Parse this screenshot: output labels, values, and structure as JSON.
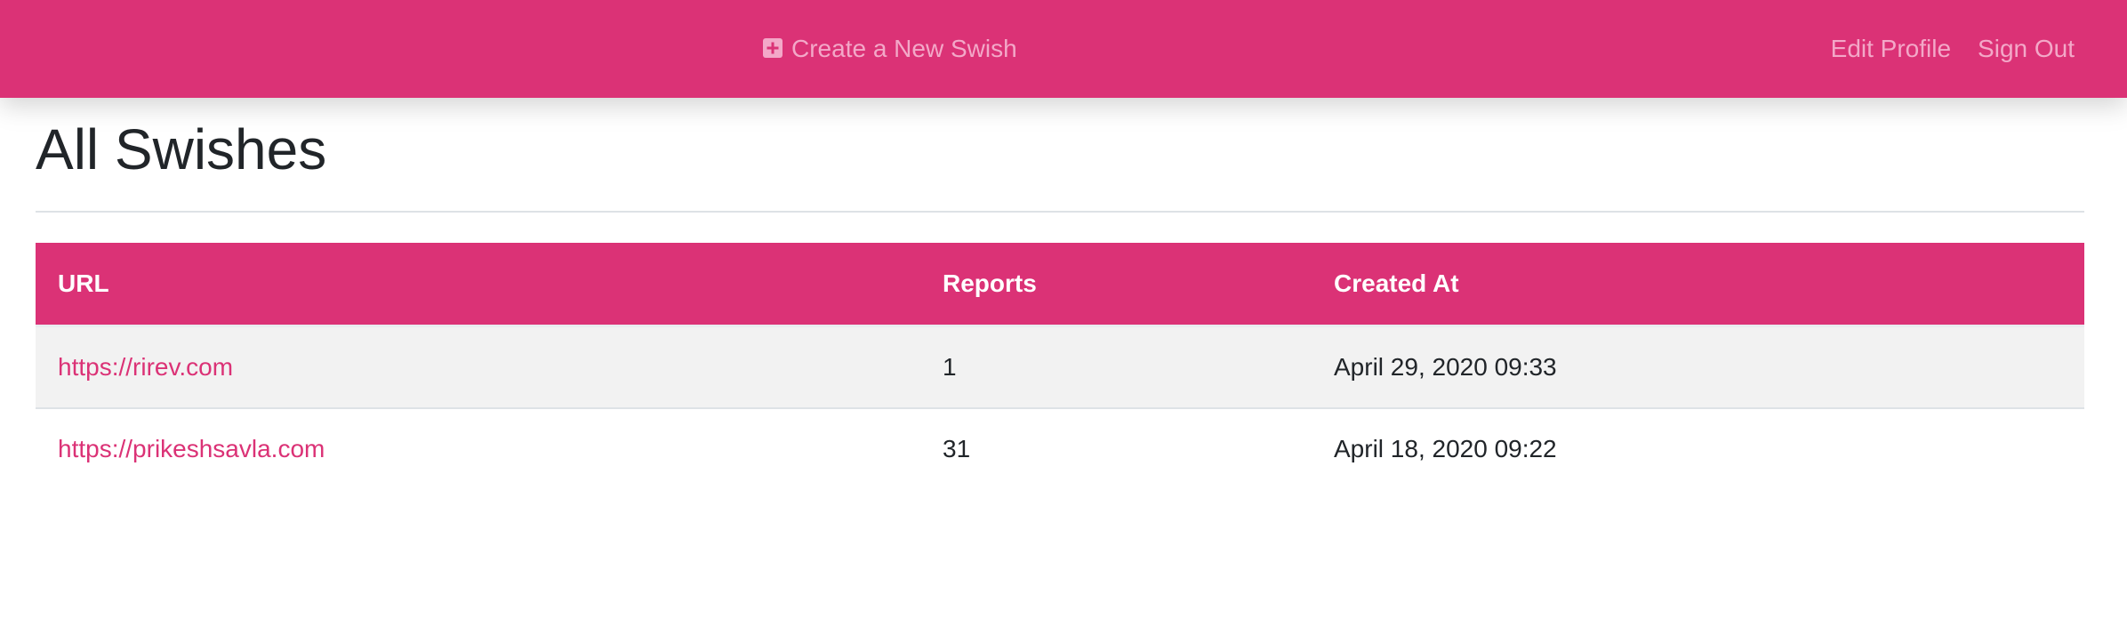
{
  "navbar": {
    "create_label": "Create a New Swish",
    "edit_profile_label": "Edit Profile",
    "sign_out_label": "Sign Out",
    "create_icon": "plus-square-icon",
    "background_color": "#db3276",
    "link_color": "#f3a8c8"
  },
  "page": {
    "title": "All Swishes"
  },
  "table": {
    "headers": [
      "URL",
      "Reports",
      "Created At"
    ],
    "rows": [
      {
        "url": "https://rirev.com",
        "reports": "1",
        "created_at": "April 29, 2020 09:33"
      },
      {
        "url": "https://prikeshsavla.com",
        "reports": "31",
        "created_at": "April 18, 2020 09:22"
      }
    ]
  }
}
